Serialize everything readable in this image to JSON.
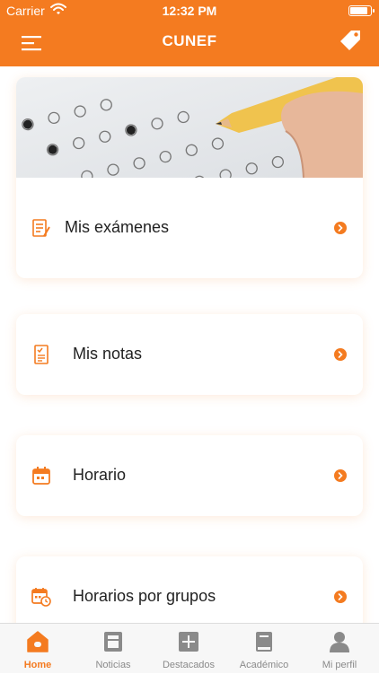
{
  "status_bar": {
    "carrier": "Carrier",
    "time": "12:32 PM"
  },
  "header": {
    "title": "CUNEF"
  },
  "menu": {
    "items": [
      {
        "label": "Mis exámenes",
        "icon": "exam-list-icon"
      },
      {
        "label": "Mis notas",
        "icon": "grades-document-icon"
      },
      {
        "label": "Horario",
        "icon": "calendar-icon"
      },
      {
        "label": "Horarios por grupos",
        "icon": "calendar-clock-icon"
      }
    ]
  },
  "tabs": [
    {
      "label": "Home",
      "icon": "home-icon",
      "active": true
    },
    {
      "label": "Noticias",
      "icon": "news-icon",
      "active": false
    },
    {
      "label": "Destacados",
      "icon": "plus-icon",
      "active": false
    },
    {
      "label": "Académico",
      "icon": "book-icon",
      "active": false
    },
    {
      "label": "Mi perfil",
      "icon": "user-icon",
      "active": false
    }
  ],
  "colors": {
    "accent": "#f47b20",
    "tab_inactive": "#8a8a8a",
    "background": "#ffffff"
  }
}
